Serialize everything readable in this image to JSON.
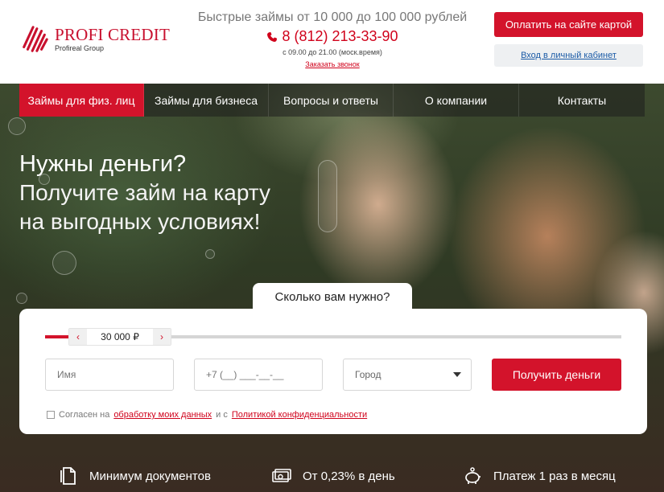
{
  "header": {
    "logo_name": "PROFI CREDIT",
    "logo_sub": "Profireal Group",
    "tagline": "Быстрые займы от 10 000 до 100 000 рублей",
    "phone": "8 (812) 213-33-90",
    "hours": "с 09.00 до 21.00 (моск.время)",
    "callback": "Заказать звонок",
    "pay_button": "Оплатить на сайте картой",
    "cabinet_button": "Вход в личный кабинет"
  },
  "nav": {
    "items": [
      {
        "label": "Займы для физ. лиц",
        "active": true
      },
      {
        "label": "Займы для бизнеса",
        "active": false
      },
      {
        "label": "Вопросы и ответы",
        "active": false
      },
      {
        "label": "О компании",
        "active": false
      },
      {
        "label": "Контакты",
        "active": false
      }
    ]
  },
  "hero": {
    "title": "Нужны деньги?",
    "subtitle_line1": "Получите займ на карту",
    "subtitle_line2": "на выгодных условиях!"
  },
  "calculator": {
    "tab_label": "Сколько вам нужно?",
    "amount": "30 000 ₽",
    "amount_fraction": 0.05,
    "name_placeholder": "Имя",
    "phone_placeholder": "+7 (__) ___-__-__",
    "city_placeholder": "Город",
    "submit": "Получить деньги",
    "consent_prefix": "Согласен на",
    "consent_link1": "обработку моих данных",
    "consent_middle": "и с",
    "consent_link2": "Политикой конфиденциальности"
  },
  "features": [
    {
      "icon": "document-icon",
      "label": "Минимум документов"
    },
    {
      "icon": "cash-icon",
      "label": "От 0,23% в день"
    },
    {
      "icon": "piggy-bank-icon",
      "label": "Платеж 1 раз в месяц"
    }
  ],
  "colors": {
    "brand_red": "#d3132b",
    "link_blue": "#1a5aa6"
  }
}
